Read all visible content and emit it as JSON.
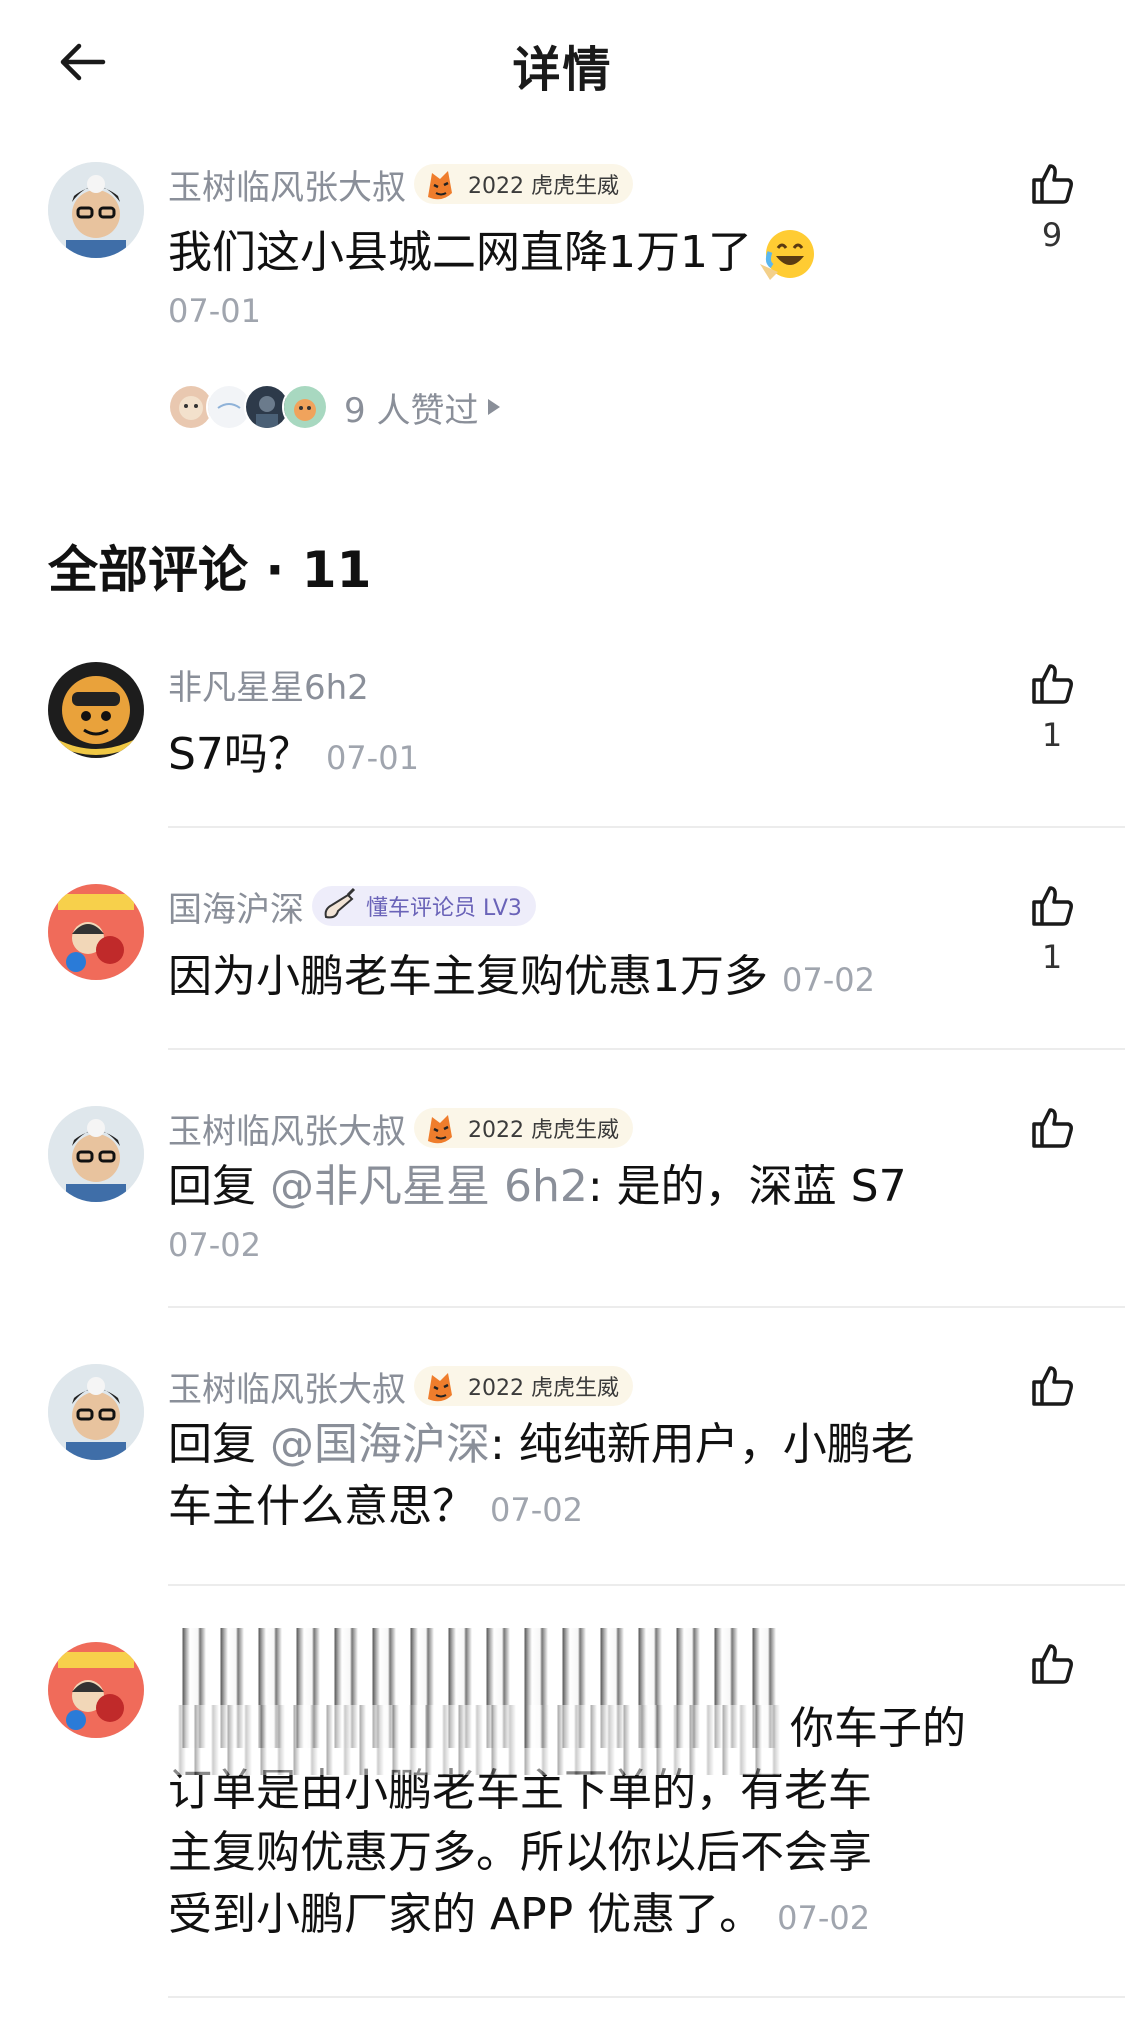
{
  "header": {
    "title": "详情"
  },
  "post": {
    "username": "玉树临风张大叔",
    "badge": "2022 虎虎生威",
    "content": "我们这小县城二网直降1万1了",
    "time": "07-01",
    "likes": "9",
    "likers_text": "9 人赞过"
  },
  "comments_header": "全部评论 · 11",
  "comments": [
    {
      "username": "非凡星星6h2",
      "text": "S7吗？",
      "time": "07-01",
      "likes": "1"
    },
    {
      "username": "国海沪深",
      "badge": "懂车评论员 LV3",
      "text": "因为小鹏老车主复购优惠1万多",
      "time": "07-02",
      "likes": "1"
    },
    {
      "username": "玉树临风张大叔",
      "badge": "2022 虎虎生威",
      "reply_prefix": "回复 ",
      "mention": "@非凡星星 6h2",
      "text": ": 是的，深蓝 S7",
      "time": "07-02"
    },
    {
      "username": "玉树临风张大叔",
      "badge": "2022 虎虎生威",
      "reply_prefix": "回复 ",
      "mention": "@国海沪深",
      "text_line1": ": 纯纯新用户，小鹏老",
      "text_line2": "车主什么意思？",
      "time": "07-02"
    },
    {
      "text_line1": "你车子的",
      "text_line2": "订单是由小鹏老车主下单的，有老车",
      "text_line3": "主复购优惠万多。所以你以后不会享",
      "text_line4": "受到小鹏厂家的 APP 优惠了。",
      "time": "07-02"
    }
  ],
  "colors": {
    "meta_gray": "#8a8f99",
    "badge_bg": "#fbf6e8",
    "badge_lavender": "#eeedfa"
  }
}
